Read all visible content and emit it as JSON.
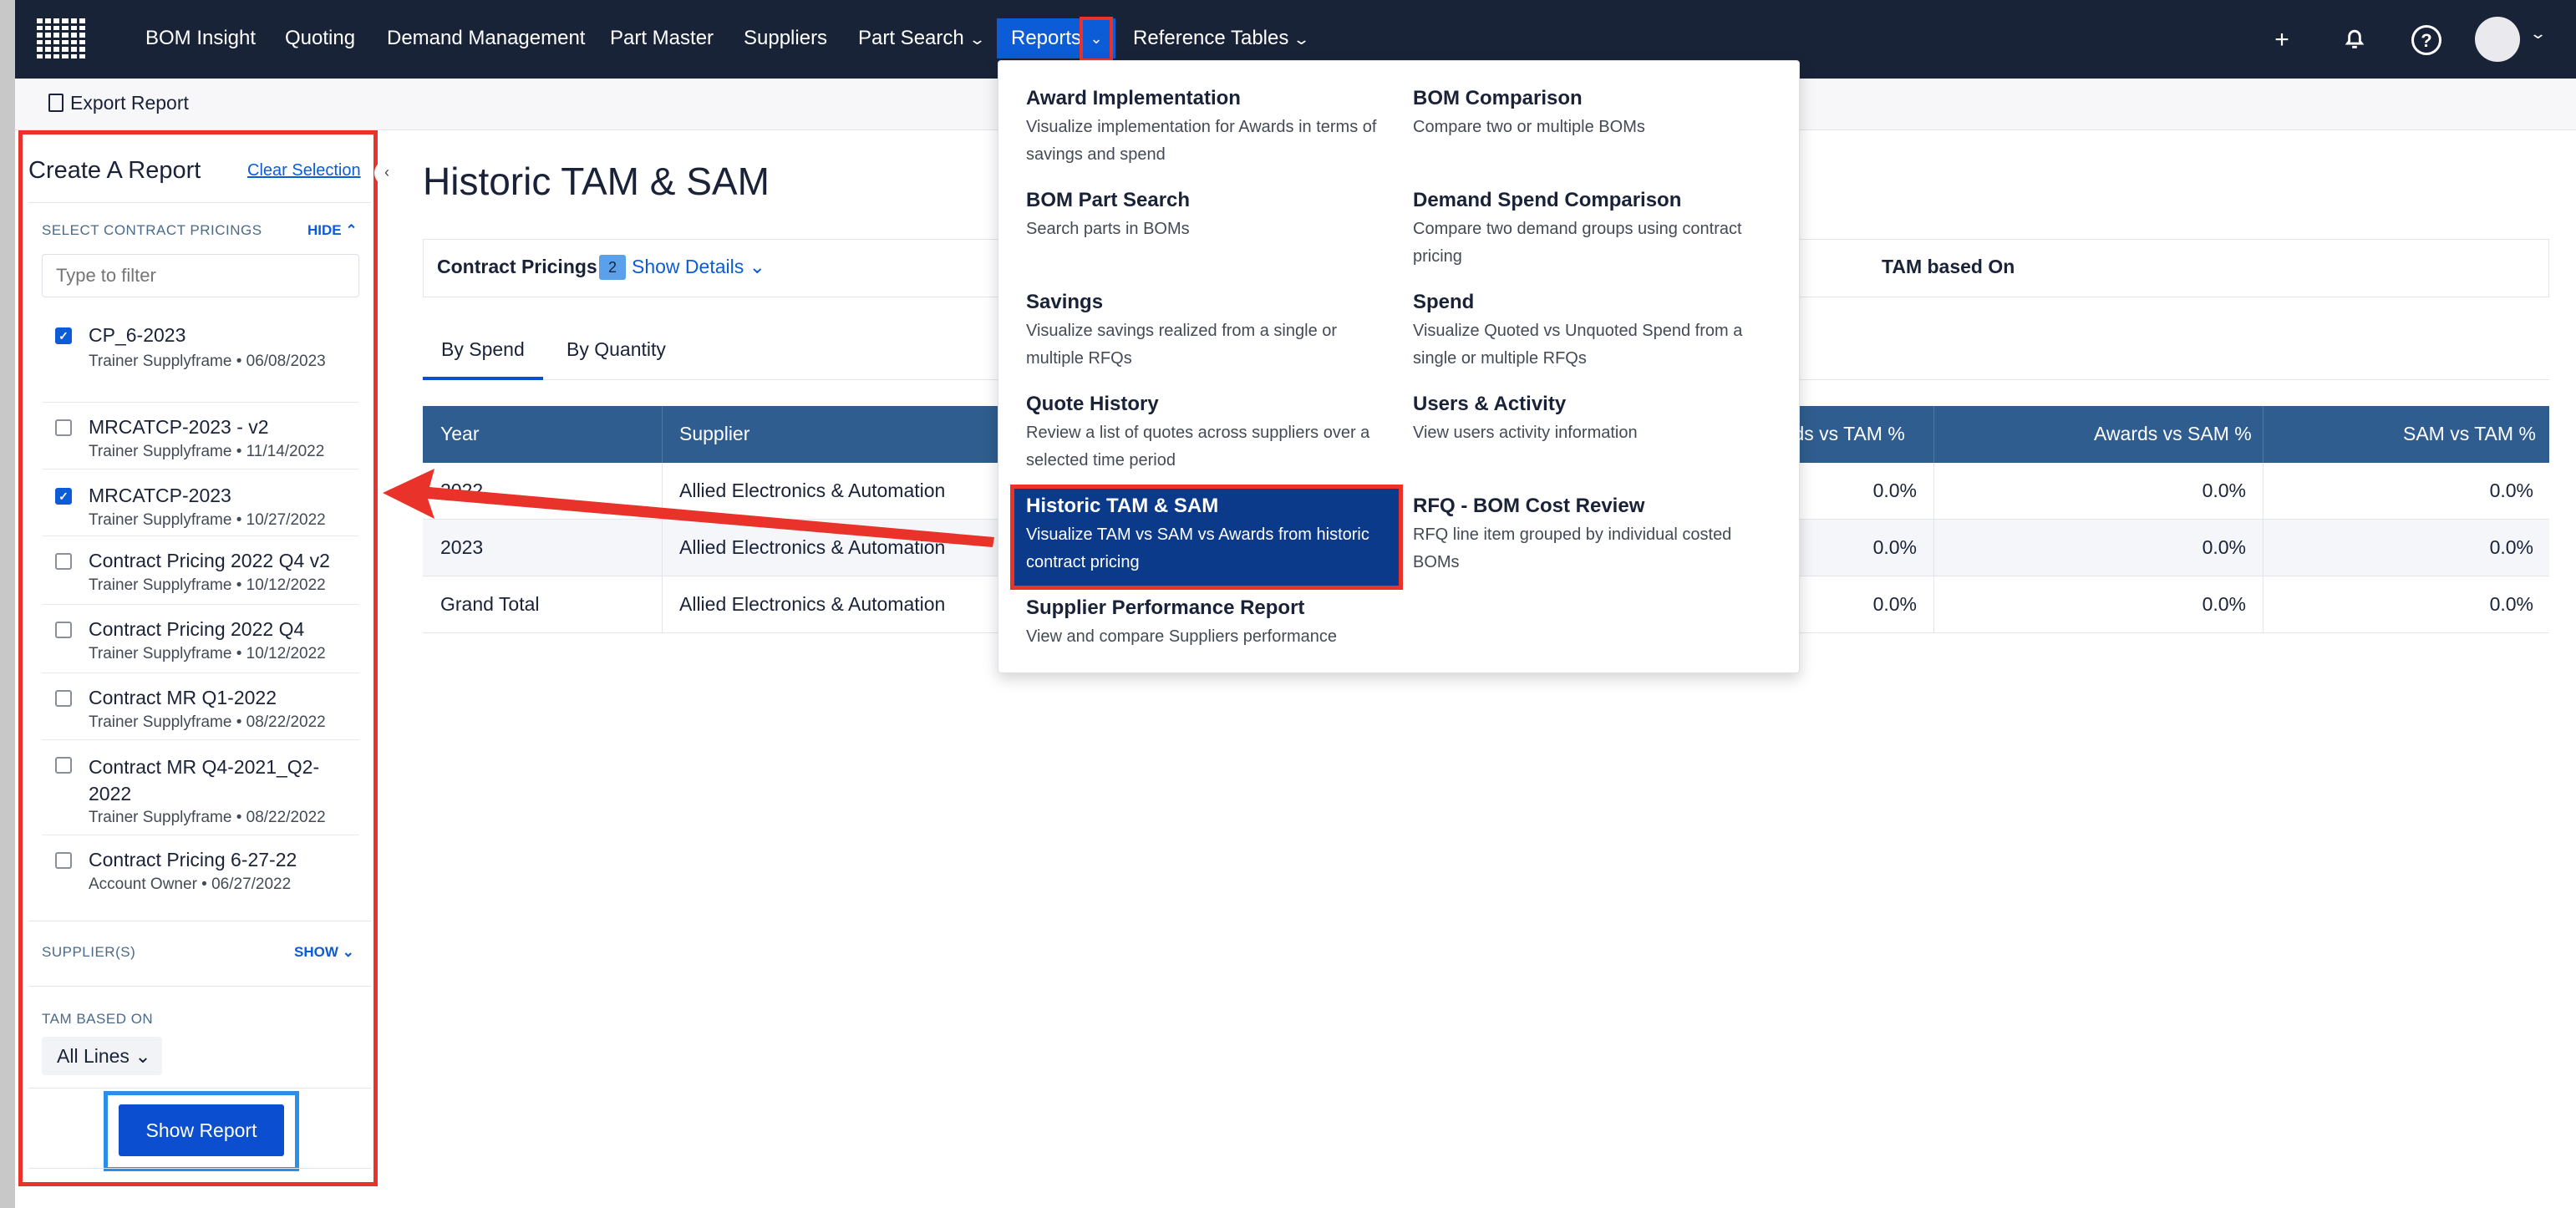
{
  "nav": {
    "items": [
      "BOM Insight",
      "Quoting",
      "Demand Management",
      "Part Master",
      "Suppliers",
      "Part Search"
    ],
    "reports_label": "Reports",
    "reference_tables": "Reference Tables",
    "plus_icon": "+",
    "bell_icon": "bell-icon",
    "help_icon": "?"
  },
  "subbar": {
    "export_label": "Export Report"
  },
  "panel": {
    "title": "Create A Report",
    "clear_selection": "Clear Selection",
    "contract_section_label": "SELECT CONTRACT PRICINGS",
    "contract_toggle": "HIDE",
    "filter_placeholder": "Type to filter",
    "items": [
      {
        "name": "CP_6-2023",
        "meta": "Trainer Supplyframe • 06/08/2023",
        "checked": true
      },
      {
        "name": "MRCATCP-2023 - v2",
        "meta": "Trainer Supplyframe • 11/14/2022",
        "checked": false
      },
      {
        "name": "MRCATCP-2023",
        "meta": "Trainer Supplyframe • 10/27/2022",
        "checked": true
      },
      {
        "name": "Contract Pricing 2022 Q4 v2",
        "meta": "Trainer Supplyframe • 10/12/2022",
        "checked": false
      },
      {
        "name": "Contract Pricing 2022 Q4",
        "meta": "Trainer Supplyframe • 10/12/2022",
        "checked": false
      },
      {
        "name": "Contract MR Q1-2022",
        "meta": "Trainer Supplyframe • 08/22/2022",
        "checked": false
      },
      {
        "name": "Contract MR Q4-2021_Q2-2022",
        "meta": "Trainer Supplyframe • 08/22/2022",
        "checked": false
      },
      {
        "name": "Contract Pricing 6-27-22",
        "meta": "Account Owner • 06/27/2022",
        "checked": false
      }
    ],
    "supplier_section_label": "SUPPLIER(S)",
    "supplier_toggle": "SHOW",
    "tam_section_label": "TAM BASED ON",
    "tam_value": "All Lines",
    "show_report": "Show Report"
  },
  "main": {
    "title": "Historic TAM & SAM",
    "contract_pricings_label": "Contract Pricings",
    "contract_count": "2",
    "show_details": "Show Details",
    "tam_based_on": "TAM based On",
    "tabs": [
      "By Spend",
      "By Quantity"
    ],
    "columns": [
      "Year",
      "Supplier",
      "ards vs TAM %",
      "Awards vs SAM %",
      "SAM vs TAM %"
    ],
    "rows": [
      {
        "year": "2022",
        "supplier": "Allied Electronics & Automation",
        "c1": "0.0%",
        "c2": "0.0%",
        "c3": "0.0%"
      },
      {
        "year": "2023",
        "supplier": "Allied Electronics & Automation",
        "c1": "0.0%",
        "c2": "0.0%",
        "c3": "0.0%"
      },
      {
        "year": "Grand Total",
        "supplier": "Allied Electronics & Automation",
        "c1": "0.0%",
        "c2": "0.0%",
        "c3": "0.0%"
      }
    ]
  },
  "menu": {
    "left": [
      {
        "title": "Award Implementation",
        "desc": "Visualize implementation for Awards in terms of savings and spend"
      },
      {
        "title": "BOM Part Search",
        "desc": "Search parts in BOMs"
      },
      {
        "title": "Savings",
        "desc": "Visualize savings realized from a single or multiple RFQs"
      },
      {
        "title": "Quote History",
        "desc": "Review a list of quotes across suppliers over a selected time period"
      },
      {
        "title": "Historic TAM & SAM",
        "desc": "Visualize TAM vs SAM vs Awards from historic contract pricing"
      },
      {
        "title": "Supplier Performance Report",
        "desc": "View and compare Suppliers performance"
      }
    ],
    "right": [
      {
        "title": "BOM Comparison",
        "desc": "Compare two or multiple BOMs"
      },
      {
        "title": "Demand Spend Comparison",
        "desc": "Compare two demand groups using contract pricing"
      },
      {
        "title": "Spend",
        "desc": "Visualize Quoted vs Unquoted Spend from a single or multiple RFQs"
      },
      {
        "title": "Users & Activity",
        "desc": "View users activity information"
      },
      {
        "title": "RFQ - BOM Cost Review",
        "desc": "RFQ line item grouped by individual costed BOMs"
      }
    ]
  },
  "colors": {
    "nav_bg": "#192338",
    "accent": "#0b5cd6",
    "highlight": "#e8322a",
    "table_header": "#2f5d8f"
  }
}
